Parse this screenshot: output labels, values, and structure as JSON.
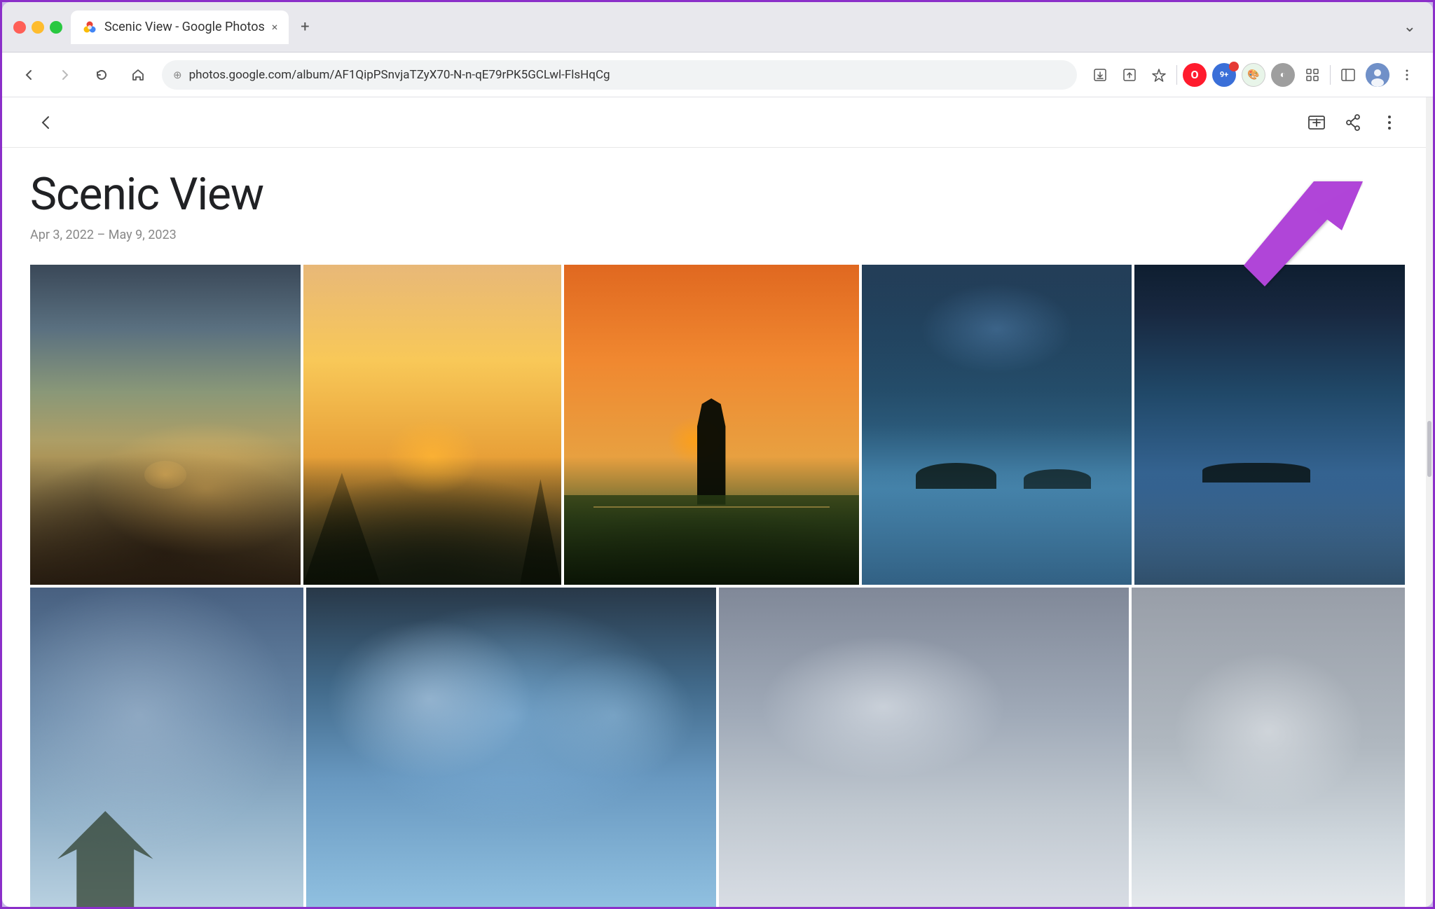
{
  "browser": {
    "tab_title": "Scenic View - Google Photos",
    "tab_close": "×",
    "new_tab": "+",
    "tab_dropdown": "⌄",
    "url": "photos.google.com/album/AF1QipPSnvjaTZyX70-N-n-qE79rPK5GCLwl-FlsHqCg",
    "url_full": "photos.google.com/album/AF1QipPSnvjaTZyX70-N-n-qE79rPK5GCLwl-FlsHqCg",
    "nav": {
      "back": "←",
      "forward": "→",
      "refresh": "↻",
      "home": "⌂"
    }
  },
  "page": {
    "title": "Scenic View",
    "date_range": "Apr 3, 2022 – May 9, 2023",
    "header": {
      "back_label": "←",
      "add_to_album_label": "⊕",
      "share_label": "share",
      "more_label": "⋮"
    }
  },
  "photos": {
    "row1": [
      {
        "id": "sunset-beach",
        "alt": "Sunset over beach/mudflat"
      },
      {
        "id": "sunset-trees",
        "alt": "Sunset through trees"
      },
      {
        "id": "monument-sunset",
        "alt": "Monument at sunset with street lamps"
      },
      {
        "id": "blue-water",
        "alt": "Blue water with distant islands"
      },
      {
        "id": "blue-water2",
        "alt": "Blue water panorama at dusk"
      }
    ],
    "row2": [
      {
        "id": "clouds1",
        "alt": "Cloudy sky with trees"
      },
      {
        "id": "clouds2",
        "alt": "Blue clouds dramatic sky"
      },
      {
        "id": "clouds3",
        "alt": "Grey cloudy sky"
      },
      {
        "id": "clouds4",
        "alt": "Light grey cloud sky"
      }
    ]
  },
  "annotation": {
    "arrow_direction": "pointing to top-right more button"
  },
  "extensions": {
    "icons": [
      "download-icon",
      "upload-icon",
      "star-icon",
      "opera-icon",
      "screenshot-icon",
      "color-icon",
      "extensions-icon",
      "sidebar-icon",
      "profile-icon",
      "menu-icon"
    ]
  }
}
